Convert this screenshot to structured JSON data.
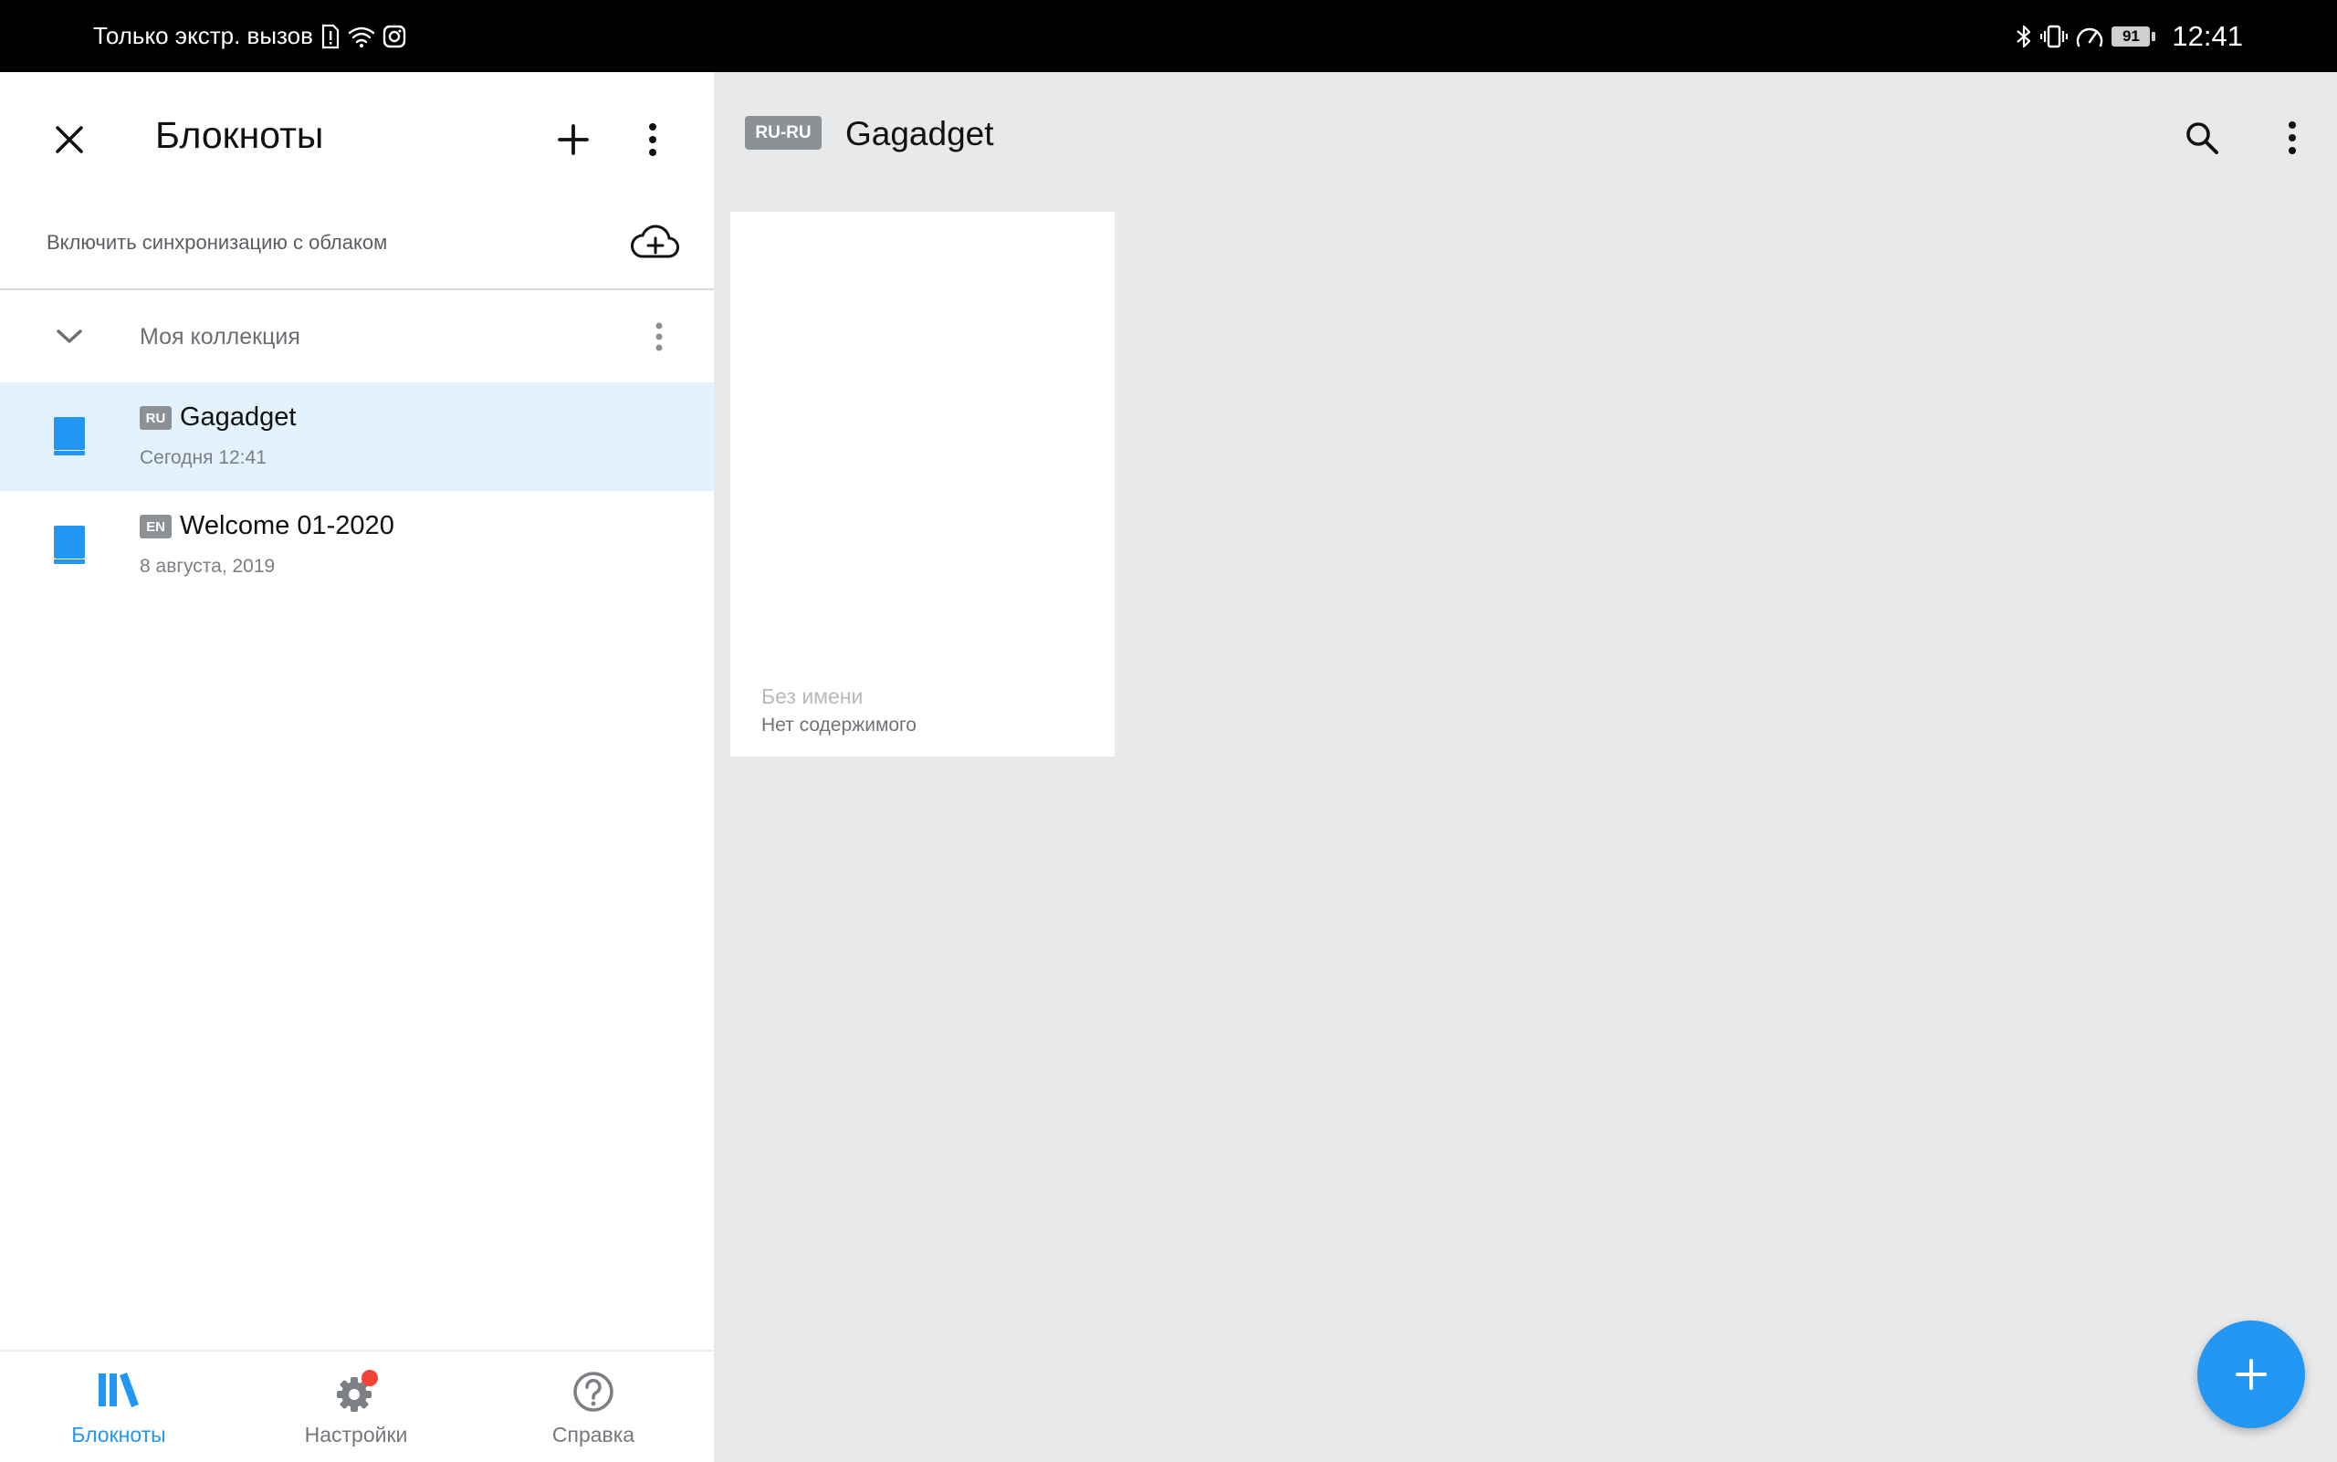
{
  "status_bar": {
    "carrier_text": "Только экстр. вызов",
    "battery_level": "91",
    "time": "12:41"
  },
  "left_panel": {
    "title": "Блокноты",
    "sync_text": "Включить синхронизацию с облаком",
    "collection": {
      "name": "Моя коллекция",
      "expanded": true
    },
    "notebooks": [
      {
        "lang": "RU",
        "title": "Gagadget",
        "date": "Сегодня 12:41",
        "selected": true
      },
      {
        "lang": "EN",
        "title": "Welcome 01-2020",
        "date": "8 августа, 2019",
        "selected": false
      }
    ],
    "bottom_nav": [
      {
        "label": "Блокноты",
        "icon": "library-books-icon",
        "active": true
      },
      {
        "label": "Настройки",
        "icon": "settings-gear-icon",
        "active": false,
        "has_badge": true
      },
      {
        "label": "Справка",
        "icon": "help-circle-icon",
        "active": false
      }
    ]
  },
  "right_panel": {
    "lang_badge": "RU-RU",
    "title": "Gagadget",
    "note": {
      "title": "Без имени",
      "content": "Нет содержимого"
    }
  },
  "colors": {
    "accent": "#2196f3",
    "selected_row": "#e3f2fc",
    "badge_gray": "#8c9196",
    "content_background": "#e8e9eb",
    "notification_dot": "#f44336"
  }
}
